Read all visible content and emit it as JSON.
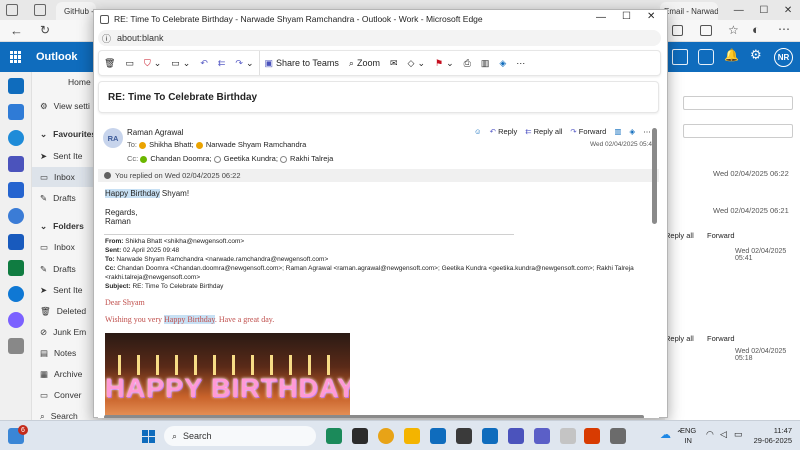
{
  "bg_browser": {
    "tabs": [
      "GitHub - Shyam27122024/Narwade...",
      "Email - Narwade Shyam Ramcha..."
    ],
    "app_name": "Outlook",
    "nav": {
      "home": "Home",
      "view_settings": "View setti",
      "favourites": "Favourites",
      "folders": "Folders"
    },
    "favourites": [
      "Sent Ite",
      "Inbox",
      "Drafts"
    ],
    "folders": [
      "Inbox",
      "Drafts",
      "Sent Ite",
      "Deleted",
      "Junk Em",
      "Notes",
      "Archive",
      "Conver",
      "Search"
    ],
    "right_dates": [
      "Wed 02/04/2025 06:22",
      "Wed 02/04/2025 06:21"
    ],
    "right_actions": {
      "reply_all": "Reply all",
      "forward": "Forward"
    },
    "right_times": [
      "Wed 02/04/2025 05:41",
      "Wed 02/04/2025 05:18"
    ],
    "avatar": "NR"
  },
  "popup": {
    "title": "RE: Time To Celebrate Birthday - Narwade Shyam Ramchandra - Outlook - Work - Microsoft Edge",
    "url": "about:blank",
    "toolbar": {
      "share": "Share to Teams",
      "zoom": "Zoom"
    },
    "subject": "RE: Time To Celebrate Birthday",
    "message": {
      "avatar": "RA",
      "sender": "Raman Agrawal",
      "to_label": "To:",
      "to": [
        "Shikha Bhatt;",
        "Narwade Shyam Ramchandra"
      ],
      "cc_label": "Cc:",
      "cc": [
        "Chandan Doomra;",
        "Geetika Kundra;",
        "Rakhi Talreja"
      ],
      "actions": {
        "reply": "Reply",
        "reply_all": "Reply all",
        "forward": "Forward"
      },
      "date": "Wed 02/04/2025 05:41",
      "replied_note": "You replied on Wed 02/04/2025 06:22",
      "body_hl": "Happy Birthday",
      "body_rest": " Shyam!",
      "regards": "Regards,",
      "sign": "Raman",
      "quoted": {
        "from_label": "From:",
        "from": " Shikha Bhatt <shikha@newgensoft.com>",
        "sent_label": "Sent:",
        "sent": " 02 April 2025 09:48",
        "to_label": "To:",
        "to": " Narwade Shyam Ramchandra <narwade.ramchandra@newgensoft.com>",
        "cc_label": "Cc:",
        "cc": " Chandan Doomra <Chandan.doomra@newgensoft.com>; Raman Agrawal <raman.agrawal@newgensoft.com>; Geetika Kundra <geetika.kundra@newgensoft.com>; Rakhi Talreja",
        "cc2": "<rakhi.talreja@newgensoft.com>",
        "subject_label": "Subject:",
        "subject": " RE: Time To Celebrate Birthday",
        "dear": "Dear Shyam",
        "wish_pre": "Wishing you very ",
        "wish_hl": "Happy Birthday",
        "wish_post": ". Have a great day."
      },
      "cake_text": "HAPPY BIRTHDAY"
    }
  },
  "taskbar": {
    "search": "Search",
    "badge": "6",
    "lang": "ENG",
    "region": "IN",
    "time": "11:47",
    "date": "29-06-2025"
  },
  "colors": {
    "accent": "#0f6cbd",
    "quote_red": "#c0504d"
  }
}
